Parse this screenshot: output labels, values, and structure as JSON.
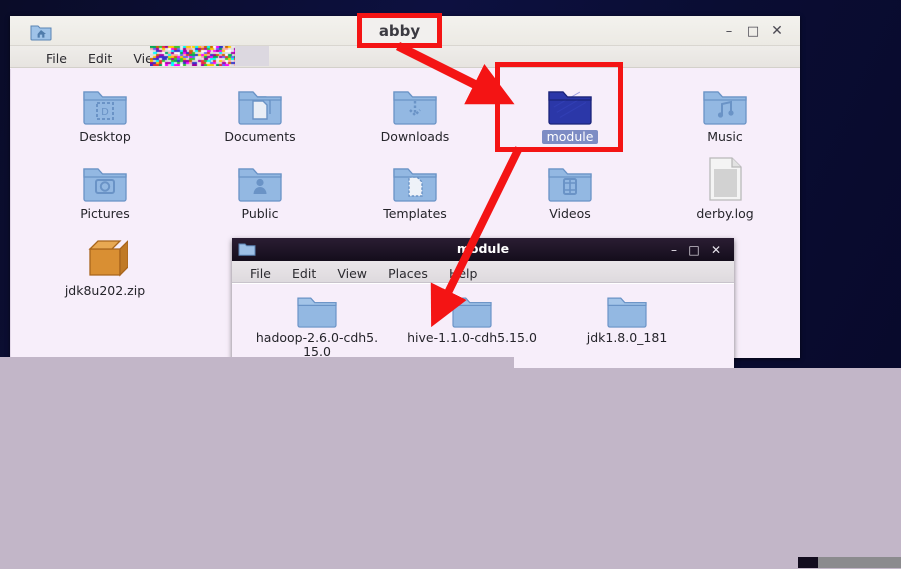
{
  "desktop": {
    "background_color": "#0d1040"
  },
  "overlay": {
    "color": "#c2b6c8"
  },
  "main_window": {
    "title": "abby",
    "icon": "home-folder-icon",
    "menus": [
      "File",
      "Edit",
      "View"
    ],
    "controls": {
      "minimize": "–",
      "maximize": "□",
      "close": "✕"
    },
    "items": [
      {
        "label": "Desktop",
        "icon": "folder-desktop-icon",
        "selected": false
      },
      {
        "label": "Documents",
        "icon": "folder-documents-icon",
        "selected": false
      },
      {
        "label": "Downloads",
        "icon": "folder-downloads-icon",
        "selected": false
      },
      {
        "label": "module",
        "icon": "folder-module-icon",
        "selected": true
      },
      {
        "label": "Music",
        "icon": "folder-music-icon",
        "selected": false
      },
      {
        "label": "Pictures",
        "icon": "folder-pictures-icon",
        "selected": false
      },
      {
        "label": "Public",
        "icon": "folder-public-icon",
        "selected": false
      },
      {
        "label": "Templates",
        "icon": "folder-templates-icon",
        "selected": false
      },
      {
        "label": "Videos",
        "icon": "folder-videos-icon",
        "selected": false
      },
      {
        "label": "derby.log",
        "icon": "text-file-icon",
        "selected": false
      },
      {
        "label": "jdk8u202.zip",
        "icon": "archive-icon",
        "selected": false
      }
    ]
  },
  "module_window": {
    "title": "module",
    "icon": "folder-icon",
    "menus": [
      "File",
      "Edit",
      "View",
      "Places",
      "Help"
    ],
    "controls": {
      "minimize": "–",
      "maximize": "□",
      "close": "✕"
    },
    "items": [
      {
        "label": "hadoop-2.6.0-cdh5.",
        "label2": "15.0",
        "icon": "folder-icon"
      },
      {
        "label": "hive-1.1.0-cdh5.15.0",
        "label2": "",
        "icon": "folder-icon"
      },
      {
        "label": "jdk1.8.0_181",
        "label2": "",
        "icon": "folder-icon"
      }
    ]
  },
  "annotations": {
    "color": "#f41414",
    "title_callout": "abby",
    "boxes": [
      "abby-title-box",
      "module-folder-box"
    ],
    "arrows": [
      "abby-to-module-arrow",
      "module-to-window-arrow"
    ]
  }
}
